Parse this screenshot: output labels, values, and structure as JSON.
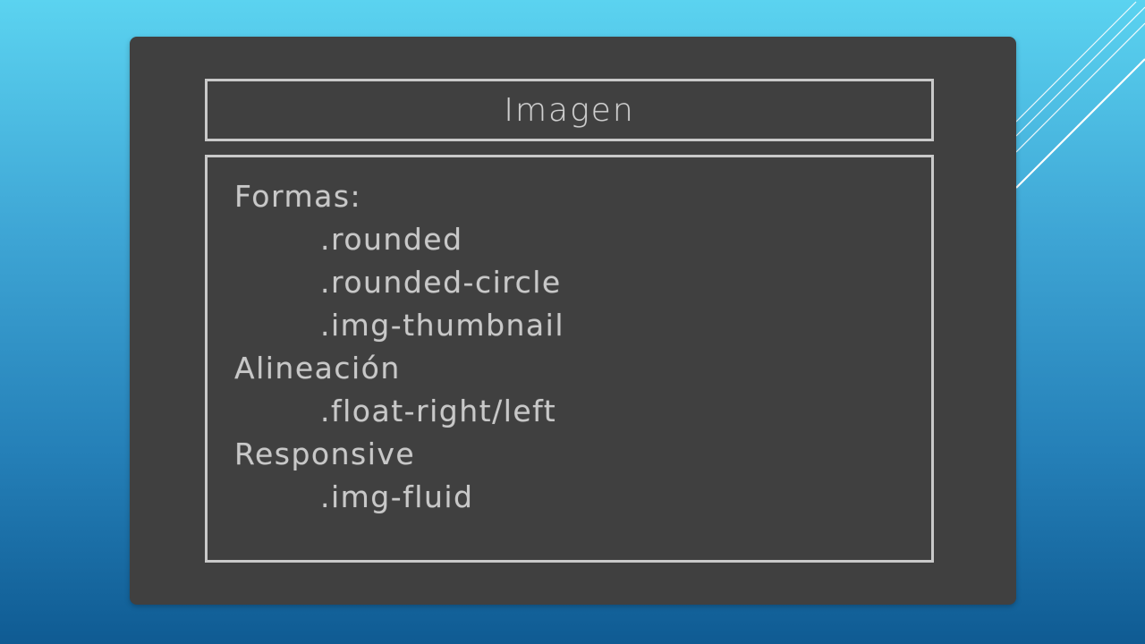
{
  "slide": {
    "title": "Imagen",
    "lines": [
      {
        "text": "Formas:",
        "indent": false
      },
      {
        "text": ".rounded",
        "indent": true
      },
      {
        "text": ".rounded-circle",
        "indent": true
      },
      {
        "text": ".img-thumbnail",
        "indent": true
      },
      {
        "text": "Alineación",
        "indent": false
      },
      {
        "text": ".float-right/left",
        "indent": true
      },
      {
        "text": "Responsive",
        "indent": false
      },
      {
        "text": ".img-fluid",
        "indent": true
      }
    ]
  },
  "colors": {
    "background_top": "#5bd3f0",
    "background_bottom": "#0f5b93",
    "board": "#404040",
    "chalk": "#c8c8c8",
    "frame": "#c9c9c9"
  }
}
